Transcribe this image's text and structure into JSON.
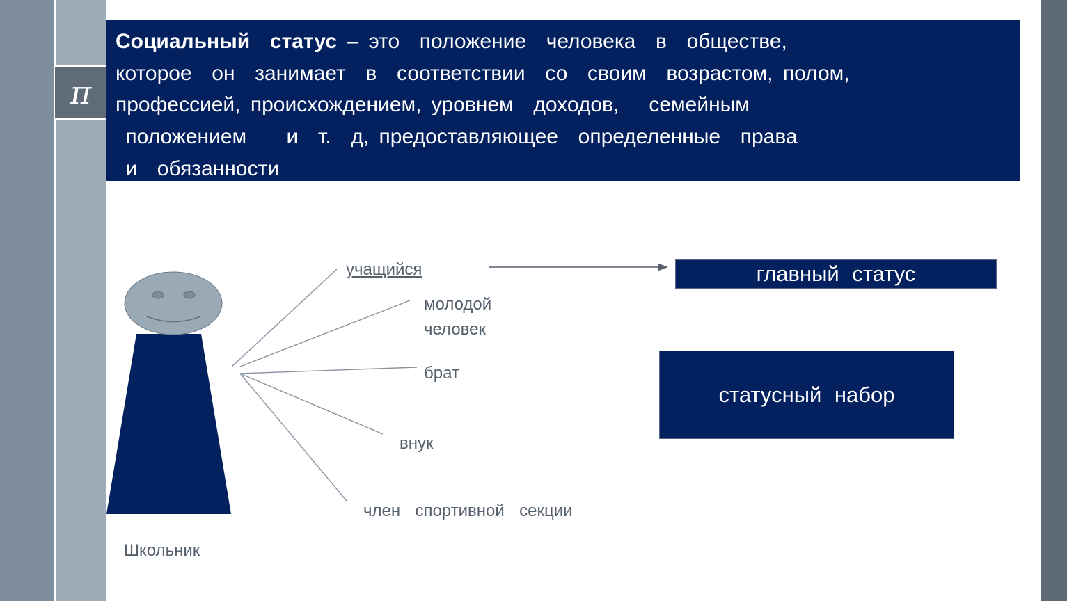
{
  "theme": {
    "navy": "#03205f",
    "band_left": "#7f8e9c",
    "band_column": "#9eacb8",
    "band_tile": "#5f6b77",
    "band_right": "#5d6a76",
    "head_fill": "#9aa9b6",
    "label_color": "#55606c"
  },
  "sidebar": {
    "icon": "pi-icon",
    "icon_glyph": "π"
  },
  "definition": {
    "term": "Социальный  статус",
    "lines": [
      " – это  положение  человека  в  обществе,",
      "которое  он  занимает  в  соответствии  со  своим  возрастом, полом,",
      "профессией, происхождением, уровнем  доходов,   семейным",
      " положением    и  т.  д, предоставляющее  определенные  права",
      " и  обязанности"
    ]
  },
  "figure": {
    "caption": "Школьник",
    "icon": "person-icon"
  },
  "statuses": [
    {
      "text": "учащийся",
      "underlined": true
    },
    {
      "text": "молодой\nчеловек",
      "underlined": false
    },
    {
      "text": "брат",
      "underlined": false
    },
    {
      "text": "внук",
      "underlined": false
    },
    {
      "text": "член  спортивной  секции",
      "underlined": false
    }
  ],
  "boxes": {
    "main_status": "главный   статус",
    "status_set": "статусный   набор"
  }
}
